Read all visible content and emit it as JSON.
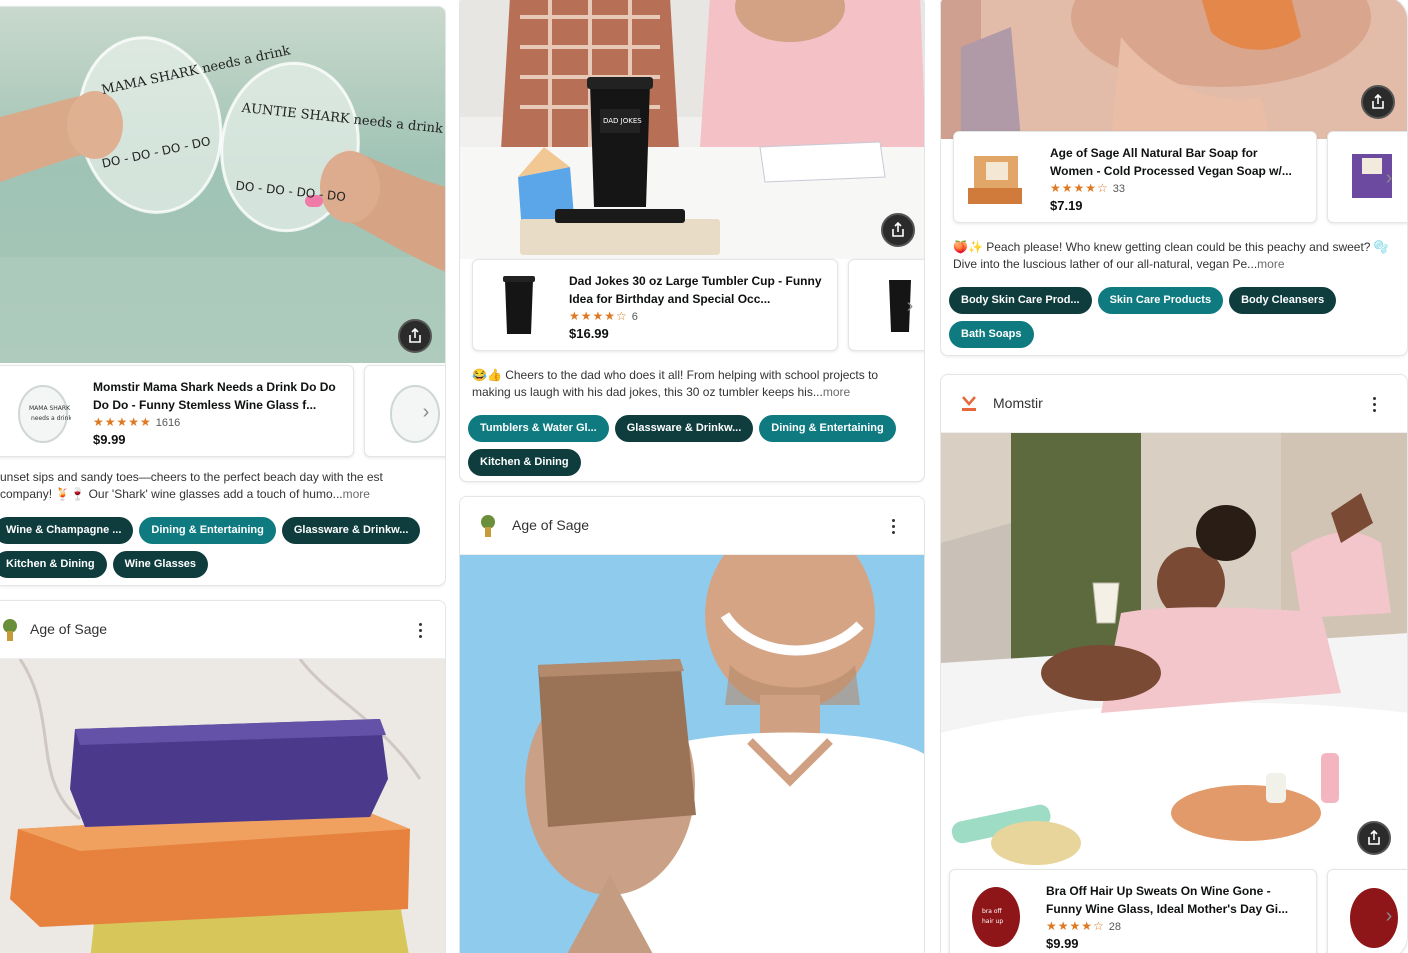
{
  "colors": {
    "tag_dark": "#0f3d3e",
    "tag_teal": "#0f7b80",
    "star": "#de7921",
    "accent_amazon_orange": "#ff9900"
  },
  "columns": [
    {
      "posts": [
        {
          "product": {
            "title": "Momstir Mama Shark Needs a Drink Do Do Do Do - Funny Stemless Wine Glass f...",
            "stars": "★★★★★",
            "rating_count": "1616",
            "price": "$9.99"
          },
          "caption": "unset sips and sandy toes—cheers to the perfect beach day with the est company! 🍹🍷 Our 'Shark' wine glasses add a touch of humo...",
          "more": "more",
          "tags": [
            {
              "label": "Wine & Champagne ...",
              "style": "dark"
            },
            {
              "label": "Dining & Entertaining",
              "style": "teal"
            },
            {
              "label": "Glassware & Drinkw...",
              "style": "dark"
            },
            {
              "label": "Kitchen & Dining",
              "style": "dark"
            },
            {
              "label": "Wine Glasses",
              "style": "dark"
            }
          ],
          "glass_text": [
            "MAMA SHARK needs a drink",
            "AUNTIE SHARK needs a drink"
          ]
        },
        {
          "brand": "Age of Sage",
          "icon": "menu-kebab-icon"
        }
      ]
    },
    {
      "posts": [
        {
          "product": {
            "title": "Dad Jokes 30 oz Large Tumbler Cup - Funny Idea for Birthday and Special Occ...",
            "stars": "★★★★☆",
            "rating_count": "6",
            "price": "$16.99"
          },
          "caption": "😂👍 Cheers to the dad who does it all! From helping with school projects to making us laugh with his dad jokes, this 30 oz tumbler keeps his...",
          "more": "more",
          "tags": [
            {
              "label": "Tumblers & Water Gl...",
              "style": "teal"
            },
            {
              "label": "Glassware & Drinkw...",
              "style": "dark"
            },
            {
              "label": "Dining & Entertaining",
              "style": "teal"
            },
            {
              "label": "Kitchen & Dining",
              "style": "dark"
            }
          ]
        },
        {
          "brand": "Age of Sage",
          "icon": "menu-kebab-icon"
        }
      ]
    },
    {
      "posts": [
        {
          "product": {
            "title": "Age of Sage All Natural Bar Soap for Women - Cold Processed Vegan Soap w/...",
            "stars": "★★★★☆",
            "rating_count": "33",
            "price": "$7.19"
          },
          "caption": "🍑✨ Peach please! Who knew getting clean could be this peachy and sweet? 🫧 Dive into the luscious lather of our all-natural, vegan Pe...",
          "more": "more",
          "tags": [
            {
              "label": "Body Skin Care Prod...",
              "style": "dark"
            },
            {
              "label": "Skin Care Products",
              "style": "teal"
            },
            {
              "label": "Body Cleansers",
              "style": "dark"
            },
            {
              "label": "Bath Soaps",
              "style": "teal"
            }
          ]
        },
        {
          "brand": "Momstir",
          "product": {
            "title": "Bra Off Hair Up Sweats On Wine Gone - Funny Wine Glass, Ideal Mother's Day Gi...",
            "stars": "★★★★☆",
            "rating_count": "28",
            "price": "$9.99"
          }
        }
      ]
    }
  ]
}
